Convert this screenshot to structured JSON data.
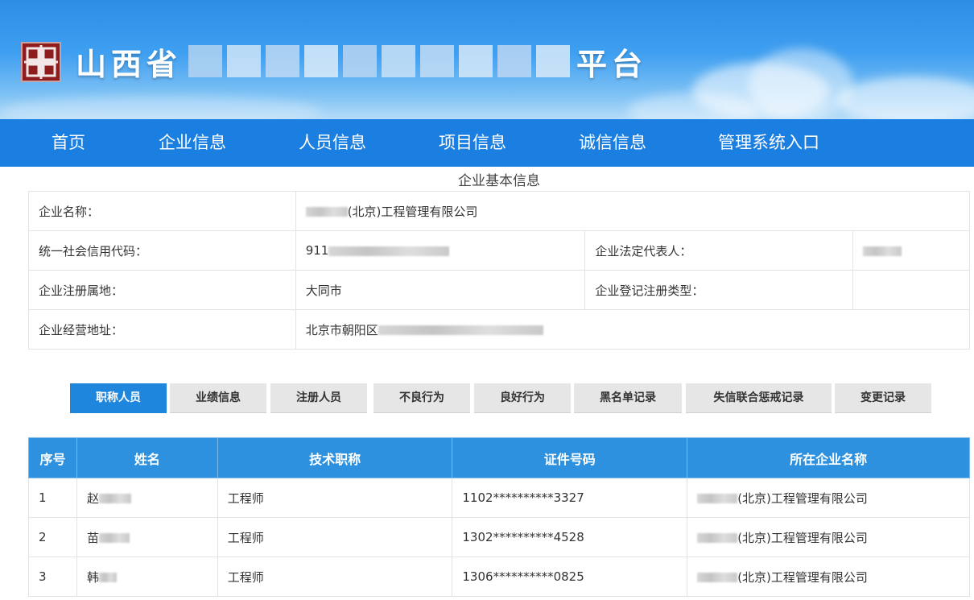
{
  "header": {
    "title_start": "山西省",
    "title_end": "平台",
    "colors": {
      "banner": "#2d8de6",
      "nav": "#1a7fe0",
      "accent": "#1e86dc"
    },
    "logo_icon": "seal-logo-icon"
  },
  "nav": {
    "items": [
      {
        "label": "首页"
      },
      {
        "label": "企业信息"
      },
      {
        "label": "人员信息"
      },
      {
        "label": "项目信息"
      },
      {
        "label": "诚信信息"
      },
      {
        "label": "管理系统入口"
      }
    ]
  },
  "basic_info": {
    "section_title": "企业基本信息",
    "name_label": "企业名称：",
    "name_value": "(北京)工程管理有限公司",
    "credit_code_label": "统一社会信用代码：",
    "credit_code_value": "911",
    "legal_rep_label": "企业法定代表人：",
    "registered_place_label": "企业注册属地：",
    "registered_place_value": "大同市",
    "registration_type_label": "企业登记注册类型：",
    "address_label": "企业经营地址：",
    "address_value": "北京市朝阳区"
  },
  "tabs": {
    "items": [
      {
        "label": "职称人员"
      },
      {
        "label": "业绩信息"
      },
      {
        "label": "注册人员"
      },
      {
        "label": "不良行为"
      },
      {
        "label": "良好行为"
      },
      {
        "label": "黑名单记录"
      },
      {
        "label": "失信联合惩戒记录"
      },
      {
        "label": "变更记录"
      }
    ],
    "active": "职称人员"
  },
  "staff_table": {
    "headers": [
      "序号",
      "姓名",
      "技术职称",
      "证件号码",
      "所在企业名称"
    ],
    "rows": [
      {
        "index": "1",
        "name": "赵",
        "title": "工程师",
        "id_number": "1102**********3327",
        "company": "(北京)工程管理有限公司"
      },
      {
        "index": "2",
        "name": "苗",
        "title": "工程师",
        "id_number": "1302**********4528",
        "company": "(北京)工程管理有限公司"
      },
      {
        "index": "3",
        "name": "韩",
        "title": "工程师",
        "id_number": "1306**********0825",
        "company": "(北京)工程管理有限公司"
      }
    ]
  }
}
